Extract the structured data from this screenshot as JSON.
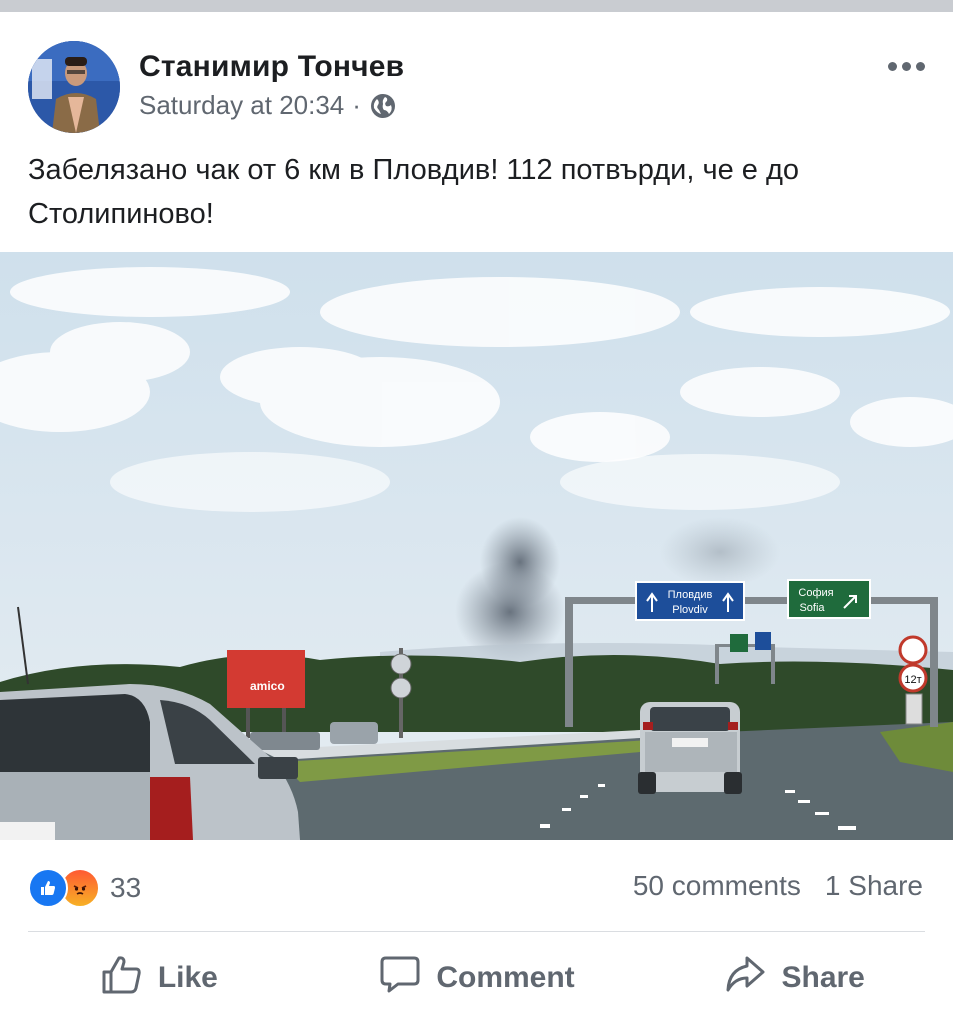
{
  "post": {
    "author": "Станимир Тончев",
    "timestamp": "Saturday at 20:34",
    "separator": "·",
    "privacy_icon": "globe-icon",
    "text": "Забелязано чак от 6 км в Пловдив! 112 потвърди, че е до Столипиново!"
  },
  "photo": {
    "sign_left_line1": "Пловдив",
    "sign_left_line2": "Plovdiv",
    "sign_right_line1": "София",
    "sign_right_line2": "Sofia",
    "billboard_text": "amico",
    "speed_sign": "12т"
  },
  "stats": {
    "reaction_icons": [
      "like-icon",
      "angry-icon"
    ],
    "reaction_count": "33",
    "comments": "50 comments",
    "shares": "1 Share"
  },
  "actions": {
    "like": "Like",
    "comment": "Comment",
    "share": "Share"
  },
  "colors": {
    "text": "#1c1e21",
    "secondary": "#606770",
    "like_blue": "#1877f2",
    "divider": "#dadde1"
  }
}
